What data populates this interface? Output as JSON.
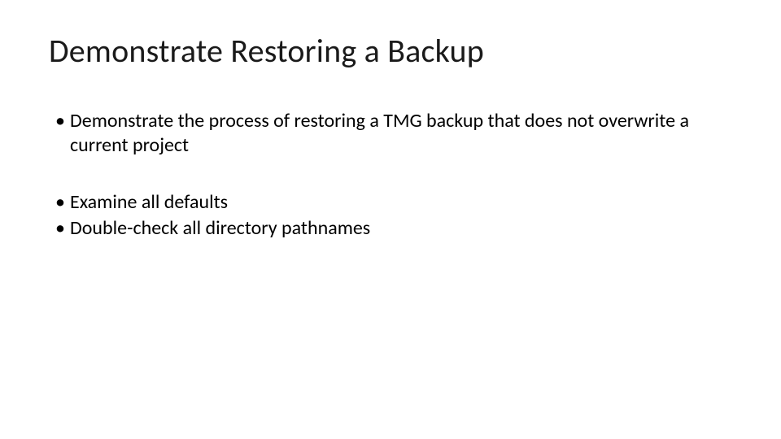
{
  "slide": {
    "title": "Demonstrate Restoring a Backup",
    "bullets_group1": [
      "Demonstrate the process of restoring a TMG backup that does not overwrite a current project"
    ],
    "bullets_group2": [
      "Examine all defaults",
      "Double-check all directory pathnames"
    ],
    "bullet_glyph": "•"
  }
}
